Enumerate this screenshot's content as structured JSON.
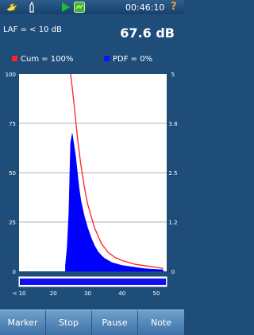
{
  "status": {
    "time": "00:46:10",
    "help_glyph": "?",
    "icons": [
      "connection-icon",
      "battery-icon",
      "play-icon",
      "app-icon"
    ]
  },
  "readout": {
    "label": "LAF = < 10 dB",
    "value": "67.6 dB"
  },
  "legend": {
    "cum": {
      "text": "Cum = 100%",
      "color": "#ff2020"
    },
    "pdf": {
      "text": "PDF = 0%",
      "color": "#1010ff"
    }
  },
  "chart_data": {
    "type": "area",
    "x_ticks": [
      "< 10",
      "20",
      "30",
      "40",
      "50"
    ],
    "y_left_ticks": [
      "100",
      "75",
      "50",
      "25",
      "0"
    ],
    "y_right_ticks": [
      "5",
      "3.8",
      "2.5",
      "1.2",
      "0"
    ],
    "xlim": [
      10,
      53
    ],
    "ylim_left": [
      0,
      100
    ],
    "ylim_right": [
      0,
      5
    ],
    "series": [
      {
        "kind": "cumulative",
        "color": "#ff2020",
        "x": [
          25.0,
          25.5,
          26,
          27,
          28,
          29,
          30,
          32,
          34,
          36,
          38,
          40,
          42,
          44,
          46,
          48,
          50,
          52
        ],
        "y": [
          100,
          93,
          85,
          68,
          54,
          43,
          34,
          22,
          14,
          9.5,
          7,
          5.5,
          4.5,
          3.5,
          3,
          2.5,
          2,
          1.5
        ]
      },
      {
        "kind": "pdf",
        "color": "#0000ff",
        "x": [
          23.5,
          24,
          24.5,
          25,
          25.5,
          26,
          26.5,
          27,
          27.5,
          28,
          29,
          30,
          31,
          32,
          33,
          34,
          35,
          36,
          37,
          38,
          40,
          42,
          44,
          46,
          48,
          50,
          52
        ],
        "y": [
          3,
          12,
          30,
          65,
          70,
          64,
          58,
          50,
          42,
          36,
          28,
          22,
          17,
          13,
          10,
          8,
          6.5,
          5.5,
          4.5,
          4,
          3,
          2.5,
          2,
          1.5,
          1.2,
          1,
          0.8
        ]
      }
    ]
  },
  "buttons": [
    "Marker",
    "Stop",
    "Pause",
    "Note"
  ]
}
